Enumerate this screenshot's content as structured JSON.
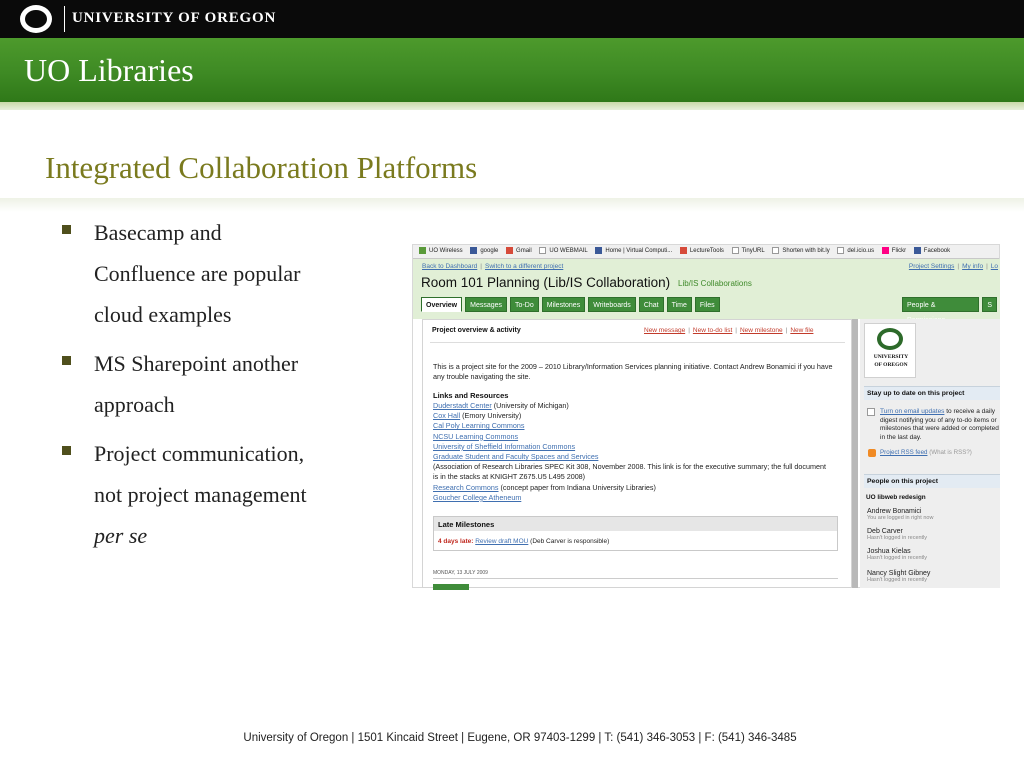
{
  "header": {
    "university_name": "UNIVERSITY OF OREGON",
    "banner_title": "UO Libraries"
  },
  "slide": {
    "title": "Integrated Collaboration Platforms",
    "bullets": [
      {
        "lines": [
          "Basecamp and",
          "Confluence are popular",
          "cloud examples"
        ]
      },
      {
        "lines": [
          "MS Sharepoint another",
          "approach"
        ]
      },
      {
        "lines": [
          "Project communication,",
          "not project management"
        ],
        "italic": "per se"
      }
    ]
  },
  "screenshot": {
    "bookmarks": [
      "UO Wireless",
      "google",
      "Gmail",
      "UO WEBMAIL",
      "Home | Virtual Computi...",
      "LectureTools",
      "TinyURL",
      "Shorten with bit.ly",
      "del.icio.us",
      "Flickr",
      "Facebook"
    ],
    "nav_left": [
      "Back to Dashboard",
      "Switch to a different project"
    ],
    "nav_right": [
      "Project Settings",
      "My info",
      "Lo"
    ],
    "project_title": "Room 101 Planning (Lib/IS Collaboration)",
    "project_subtitle": "Lib/IS Collaborations",
    "tabs": [
      "Overview",
      "Messages",
      "To-Do",
      "Milestones",
      "Writeboards",
      "Chat",
      "Time",
      "Files"
    ],
    "tabs_right": [
      "People & Permissions",
      "S"
    ],
    "overview_heading": "Project overview & activity",
    "overview_actions": [
      "New message",
      "New to-do list",
      "New milestone",
      "New file"
    ],
    "intro_text": "This is a project site for the 2009 – 2010 Library/Information Services planning initiative. Contact Andrew Bonamici if you have any trouble navigating the site.",
    "links_heading": "Links and Resources",
    "links": [
      {
        "link": "Duderstadt Center",
        "note": " (University of Michigan)"
      },
      {
        "link": "Cox Hall",
        "note": " (Emory University)"
      },
      {
        "link": "Cal Poly Learning Commons",
        "note": ""
      },
      {
        "link": "NCSU Learning Commons",
        "note": ""
      },
      {
        "link": "University of Sheffield Information Commons",
        "note": ""
      },
      {
        "link": "Graduate Student and Faculty Spaces and Services",
        "note": ""
      },
      {
        "link": "",
        "note": "(Association of Research Libraries SPEC Kit 308, November 2008. This link is for the executive summary; the full document is in the stacks at KNIGHT Z675.U5 L495 2008)"
      },
      {
        "link": "Research Commons",
        "note": " (concept paper from Indiana University Libraries)"
      },
      {
        "link": "Goucher College Atheneum",
        "note": ""
      }
    ],
    "milestones_heading": "Late Milestones",
    "milestone_late": "4 days late:",
    "milestone_link": "Review draft MOU",
    "milestone_note": " (Deb Carver is responsible)",
    "date_line": "MONDAY, 13 JULY 2009",
    "sidebar": {
      "logo_line1": "UNIVERSITY",
      "logo_line2": "OF OREGON",
      "stay_heading": "Stay up to date on this project",
      "email_link": "Turn on email updates",
      "email_text": " to receive a daily digest notifying you of any to-do items or milestones that were added or completed in the last day.",
      "rss_link": "Project RSS feed",
      "rss_note": "(What is RSS?)",
      "people_heading": "People on this project",
      "group_name": "UO libweb redesign",
      "people": [
        {
          "name": "Andrew Bonamici",
          "status": "You are logged in right now"
        },
        {
          "name": "Deb Carver",
          "status": "Hasn't logged in recently"
        },
        {
          "name": "Joshua Kielas",
          "status": "Hasn't logged in recently"
        },
        {
          "name": "Nancy Slight Gibney",
          "status": "Hasn't logged in recently"
        }
      ]
    }
  },
  "footer": {
    "text": "University of Oregon | 1501 Kincaid Street | Eugene, OR 97403-1299 | T: (541) 346-3053 | F: (541) 346-3485"
  },
  "colors": {
    "top_bar": "#0a0a0a",
    "banner_green": "#3e8a24",
    "title_olive": "#7a7a1e",
    "link_blue": "#3f6fb0",
    "tab_green": "#3f8c3a"
  }
}
